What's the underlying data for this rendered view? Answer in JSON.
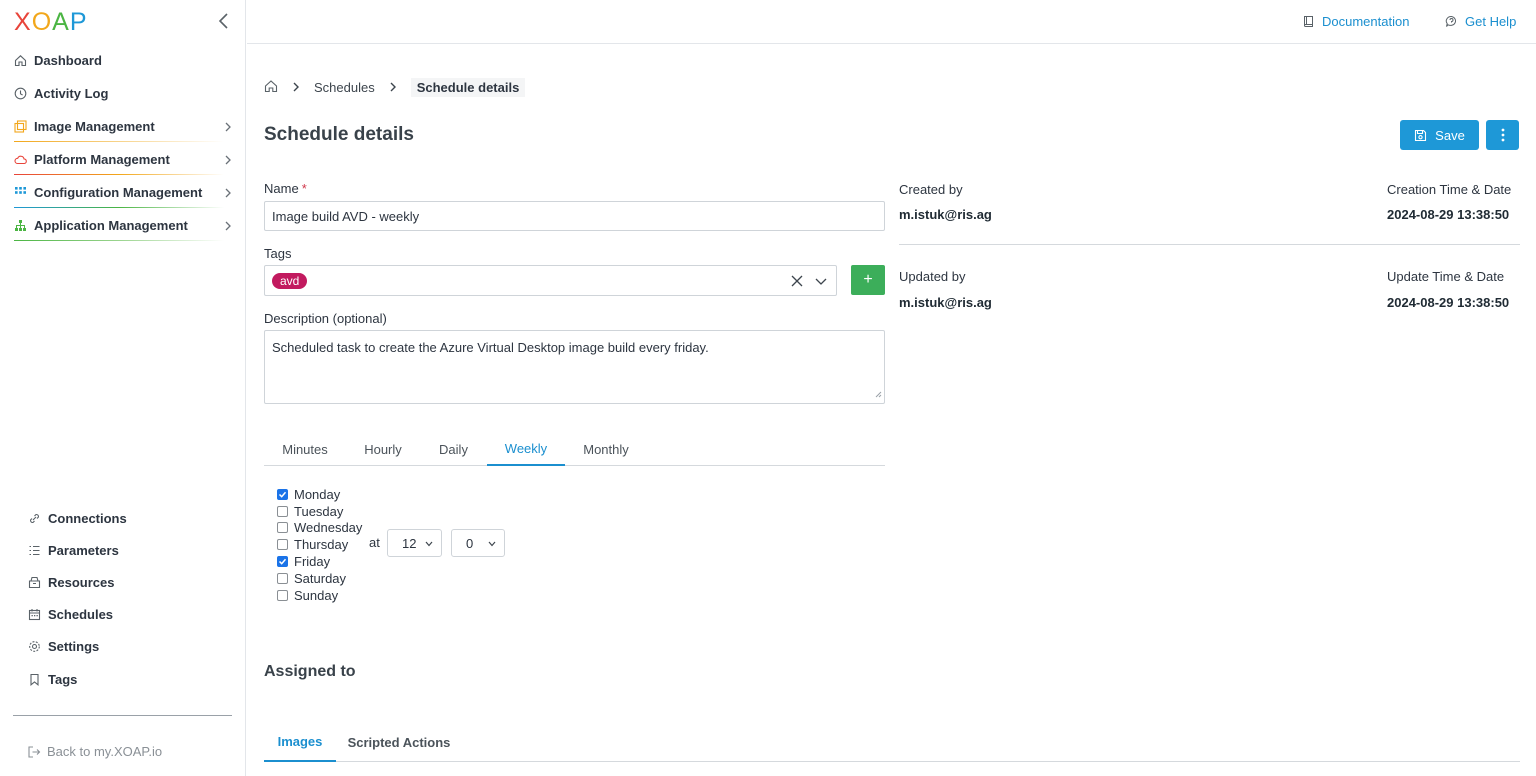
{
  "app": {
    "logo_letters": [
      "X",
      "O",
      "A",
      "P"
    ]
  },
  "colors": {
    "accent": "#1e98d7",
    "add_button": "#3cae5a",
    "tag_chip": "#c21a5f",
    "required": "#d0364a"
  },
  "sidebar": {
    "items": [
      {
        "label": "Dashboard",
        "icon": "home-icon"
      },
      {
        "label": "Activity Log",
        "icon": "clock-icon"
      },
      {
        "label": "Image Management",
        "icon": "images-icon"
      },
      {
        "label": "Platform Management",
        "icon": "cloud-icon"
      },
      {
        "label": "Configuration Management",
        "icon": "grid-icon"
      },
      {
        "label": "Application Management",
        "icon": "sitemap-icon"
      }
    ],
    "bottom_items": [
      {
        "label": "Connections",
        "icon": "link-icon"
      },
      {
        "label": "Parameters",
        "icon": "list-icon"
      },
      {
        "label": "Resources",
        "icon": "box-icon"
      },
      {
        "label": "Schedules",
        "icon": "calendar-icon"
      },
      {
        "label": "Settings",
        "icon": "gear-icon"
      },
      {
        "label": "Tags",
        "icon": "bookmark-icon"
      }
    ],
    "back_label": "Back to my.XOAP.io"
  },
  "header": {
    "documentation": "Documentation",
    "help": "Get Help"
  },
  "breadcrumb": {
    "parent": "Schedules",
    "current": "Schedule details"
  },
  "page": {
    "title": "Schedule details",
    "save_label": "Save"
  },
  "form": {
    "name_label": "Name",
    "name_required": "*",
    "name_value": "Image build AVD - weekly",
    "tags_label": "Tags",
    "tags": [
      "avd"
    ],
    "add_label": "+",
    "description_label": "Description (optional)",
    "description_value": "Scheduled task to create the Azure Virtual Desktop image build every friday."
  },
  "info": {
    "created_by_label": "Created by",
    "created_by": "m.istuk@ris.ag",
    "creation_time_label": "Creation Time & Date",
    "creation_time": "2024-08-29 13:38:50",
    "updated_by_label": "Updated by",
    "updated_by": "m.istuk@ris.ag",
    "update_time_label": "Update Time & Date",
    "update_time": "2024-08-29 13:38:50"
  },
  "schedule": {
    "tabs": [
      "Minutes",
      "Hourly",
      "Daily",
      "Weekly",
      "Monthly"
    ],
    "active_tab": "Weekly",
    "days": [
      {
        "label": "Monday",
        "checked": true
      },
      {
        "label": "Tuesday",
        "checked": false
      },
      {
        "label": "Wednesday",
        "checked": false
      },
      {
        "label": "Thursday",
        "checked": false
      },
      {
        "label": "Friday",
        "checked": true
      },
      {
        "label": "Saturday",
        "checked": false
      },
      {
        "label": "Sunday",
        "checked": false
      }
    ],
    "at_label": "at",
    "hour": "12",
    "minute": "0"
  },
  "assigned": {
    "title": "Assigned to",
    "tabs": [
      "Images",
      "Scripted Actions"
    ],
    "active_tab": "Images"
  }
}
